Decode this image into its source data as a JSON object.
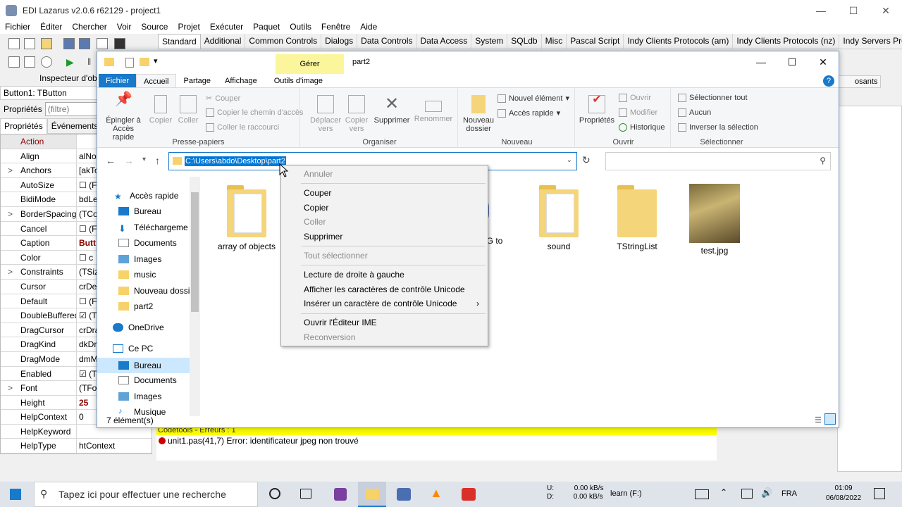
{
  "lazarus": {
    "title": "EDI Lazarus v2.0.6 r62129 - project1",
    "menu": [
      "Fichier",
      "Éditer",
      "Chercher",
      "Voir",
      "Source",
      "Projet",
      "Exécuter",
      "Paquet",
      "Outils",
      "Fenêtre",
      "Aide"
    ],
    "palette_tabs": [
      "Standard",
      "Additional",
      "Common Controls",
      "Dialogs",
      "Data Controls",
      "Data Access",
      "System",
      "SQLdb",
      "Misc",
      "Pascal Script",
      "Indy Clients Protocols (am)",
      "Indy Clients Protocols (nz)",
      "Indy Servers Protoco"
    ],
    "inspector": {
      "title": "Inspecteur d'obj",
      "component": "Button1: TButton",
      "props_label": "Propriétés",
      "filter": "(filtre)",
      "tab_props": "Propriétés",
      "tab_events": "Événements",
      "rows": [
        {
          "n": "Action",
          "v": "",
          "ex": ""
        },
        {
          "n": "Align",
          "v": "alNo",
          "ex": ""
        },
        {
          "n": "Anchors",
          "v": "[akTo",
          "ex": ">"
        },
        {
          "n": "AutoSize",
          "v": "☐ (F",
          "ex": ""
        },
        {
          "n": "BidiMode",
          "v": "bdLe",
          "ex": ""
        },
        {
          "n": "BorderSpacing",
          "v": "(TCo",
          "ex": ">"
        },
        {
          "n": "Cancel",
          "v": "☐ (F",
          "ex": ""
        },
        {
          "n": "Caption",
          "v": "Butt",
          "ex": ""
        },
        {
          "n": "Color",
          "v": "☐ c",
          "ex": ""
        },
        {
          "n": "Constraints",
          "v": "(TSiz",
          "ex": ">"
        },
        {
          "n": "Cursor",
          "v": "crDef",
          "ex": ""
        },
        {
          "n": "Default",
          "v": "☐ (F",
          "ex": ""
        },
        {
          "n": "DoubleBuffered",
          "v": "☑ (T",
          "ex": ""
        },
        {
          "n": "DragCursor",
          "v": "crDra",
          "ex": ""
        },
        {
          "n": "DragKind",
          "v": "dkDr",
          "ex": ""
        },
        {
          "n": "DragMode",
          "v": "dmM",
          "ex": ""
        },
        {
          "n": "Enabled",
          "v": "☑ (T",
          "ex": ""
        },
        {
          "n": "Font",
          "v": "(TFon",
          "ex": ">"
        },
        {
          "n": "Height",
          "v": "25",
          "ex": ""
        },
        {
          "n": "HelpContext",
          "v": "0",
          "ex": ""
        },
        {
          "n": "HelpKeyword",
          "v": "",
          "ex": ""
        },
        {
          "n": "HelpType",
          "v": "htContext",
          "ex": ""
        }
      ]
    },
    "messages": {
      "header": "Codetools - Erreurs : 1",
      "error": "unit1.pas(41,7) Error: identificateur jpeg non trouvé"
    },
    "right_tab": "osants"
  },
  "explorer": {
    "contextual_tab": "Gérer",
    "folder_name": "part2",
    "tabs": [
      "Fichier",
      "Accueil",
      "Partage",
      "Affichage",
      "Outils d'image"
    ],
    "ribbon": {
      "pin": "Épingler à\nAccès rapide",
      "copy": "Copier",
      "paste": "Coller",
      "cut": "Couper",
      "copy_path": "Copier le chemin d'accès",
      "paste_shortcut": "Coller le raccourci",
      "group_clipboard": "Presse-papiers",
      "move_to": "Déplacer\nvers",
      "copy_to": "Copier\nvers",
      "delete": "Supprimer",
      "rename": "Renommer",
      "group_organize": "Organiser",
      "new_folder": "Nouveau\ndossier",
      "new_item": "Nouvel élément",
      "easy_access": "Accès rapide",
      "group_new": "Nouveau",
      "properties": "Propriétés",
      "open": "Ouvrir",
      "edit": "Modifier",
      "history": "Historique",
      "group_open": "Ouvrir",
      "select_all": "Sélectionner tout",
      "select_none": "Aucun",
      "invert": "Inverser la sélection",
      "group_select": "Sélectionner"
    },
    "address": "C:\\Users\\abdo\\Desktop\\part2",
    "nav": [
      {
        "label": "Accès rapide"
      },
      {
        "label": "Bureau"
      },
      {
        "label": "Téléchargeme"
      },
      {
        "label": "Documents"
      },
      {
        "label": "Images"
      },
      {
        "label": "music"
      },
      {
        "label": "Nouveau dossier"
      },
      {
        "label": "part2"
      },
      {
        "label": "OneDrive"
      },
      {
        "label": "Ce PC"
      },
      {
        "label": "Bureau"
      },
      {
        "label": "Documents"
      },
      {
        "label": "Images"
      },
      {
        "label": "Musique"
      }
    ],
    "files": [
      "array of objects",
      "PG to",
      "sound",
      "TStringList",
      "test.jpg"
    ],
    "status": "7 élément(s)"
  },
  "context_menu": {
    "items": [
      "Annuler",
      "Couper",
      "Copier",
      "Coller",
      "Supprimer",
      "Tout sélectionner",
      "Lecture de droite à gauche",
      "Afficher les caractères de contrôle Unicode",
      "Insérer un caractère de contrôle Unicode",
      "Ouvrir l'Éditeur IME",
      "Reconversion"
    ]
  },
  "taskbar": {
    "search": "Tapez ici pour effectuer une recherche",
    "net_u": "U:",
    "net_d": "D:",
    "rate_u": "0.00 kB/s",
    "rate_d": "0.00 kB/s",
    "drive": "learn (F:)",
    "lang": "FRA",
    "time": "01:09",
    "date": "06/08/2022"
  }
}
